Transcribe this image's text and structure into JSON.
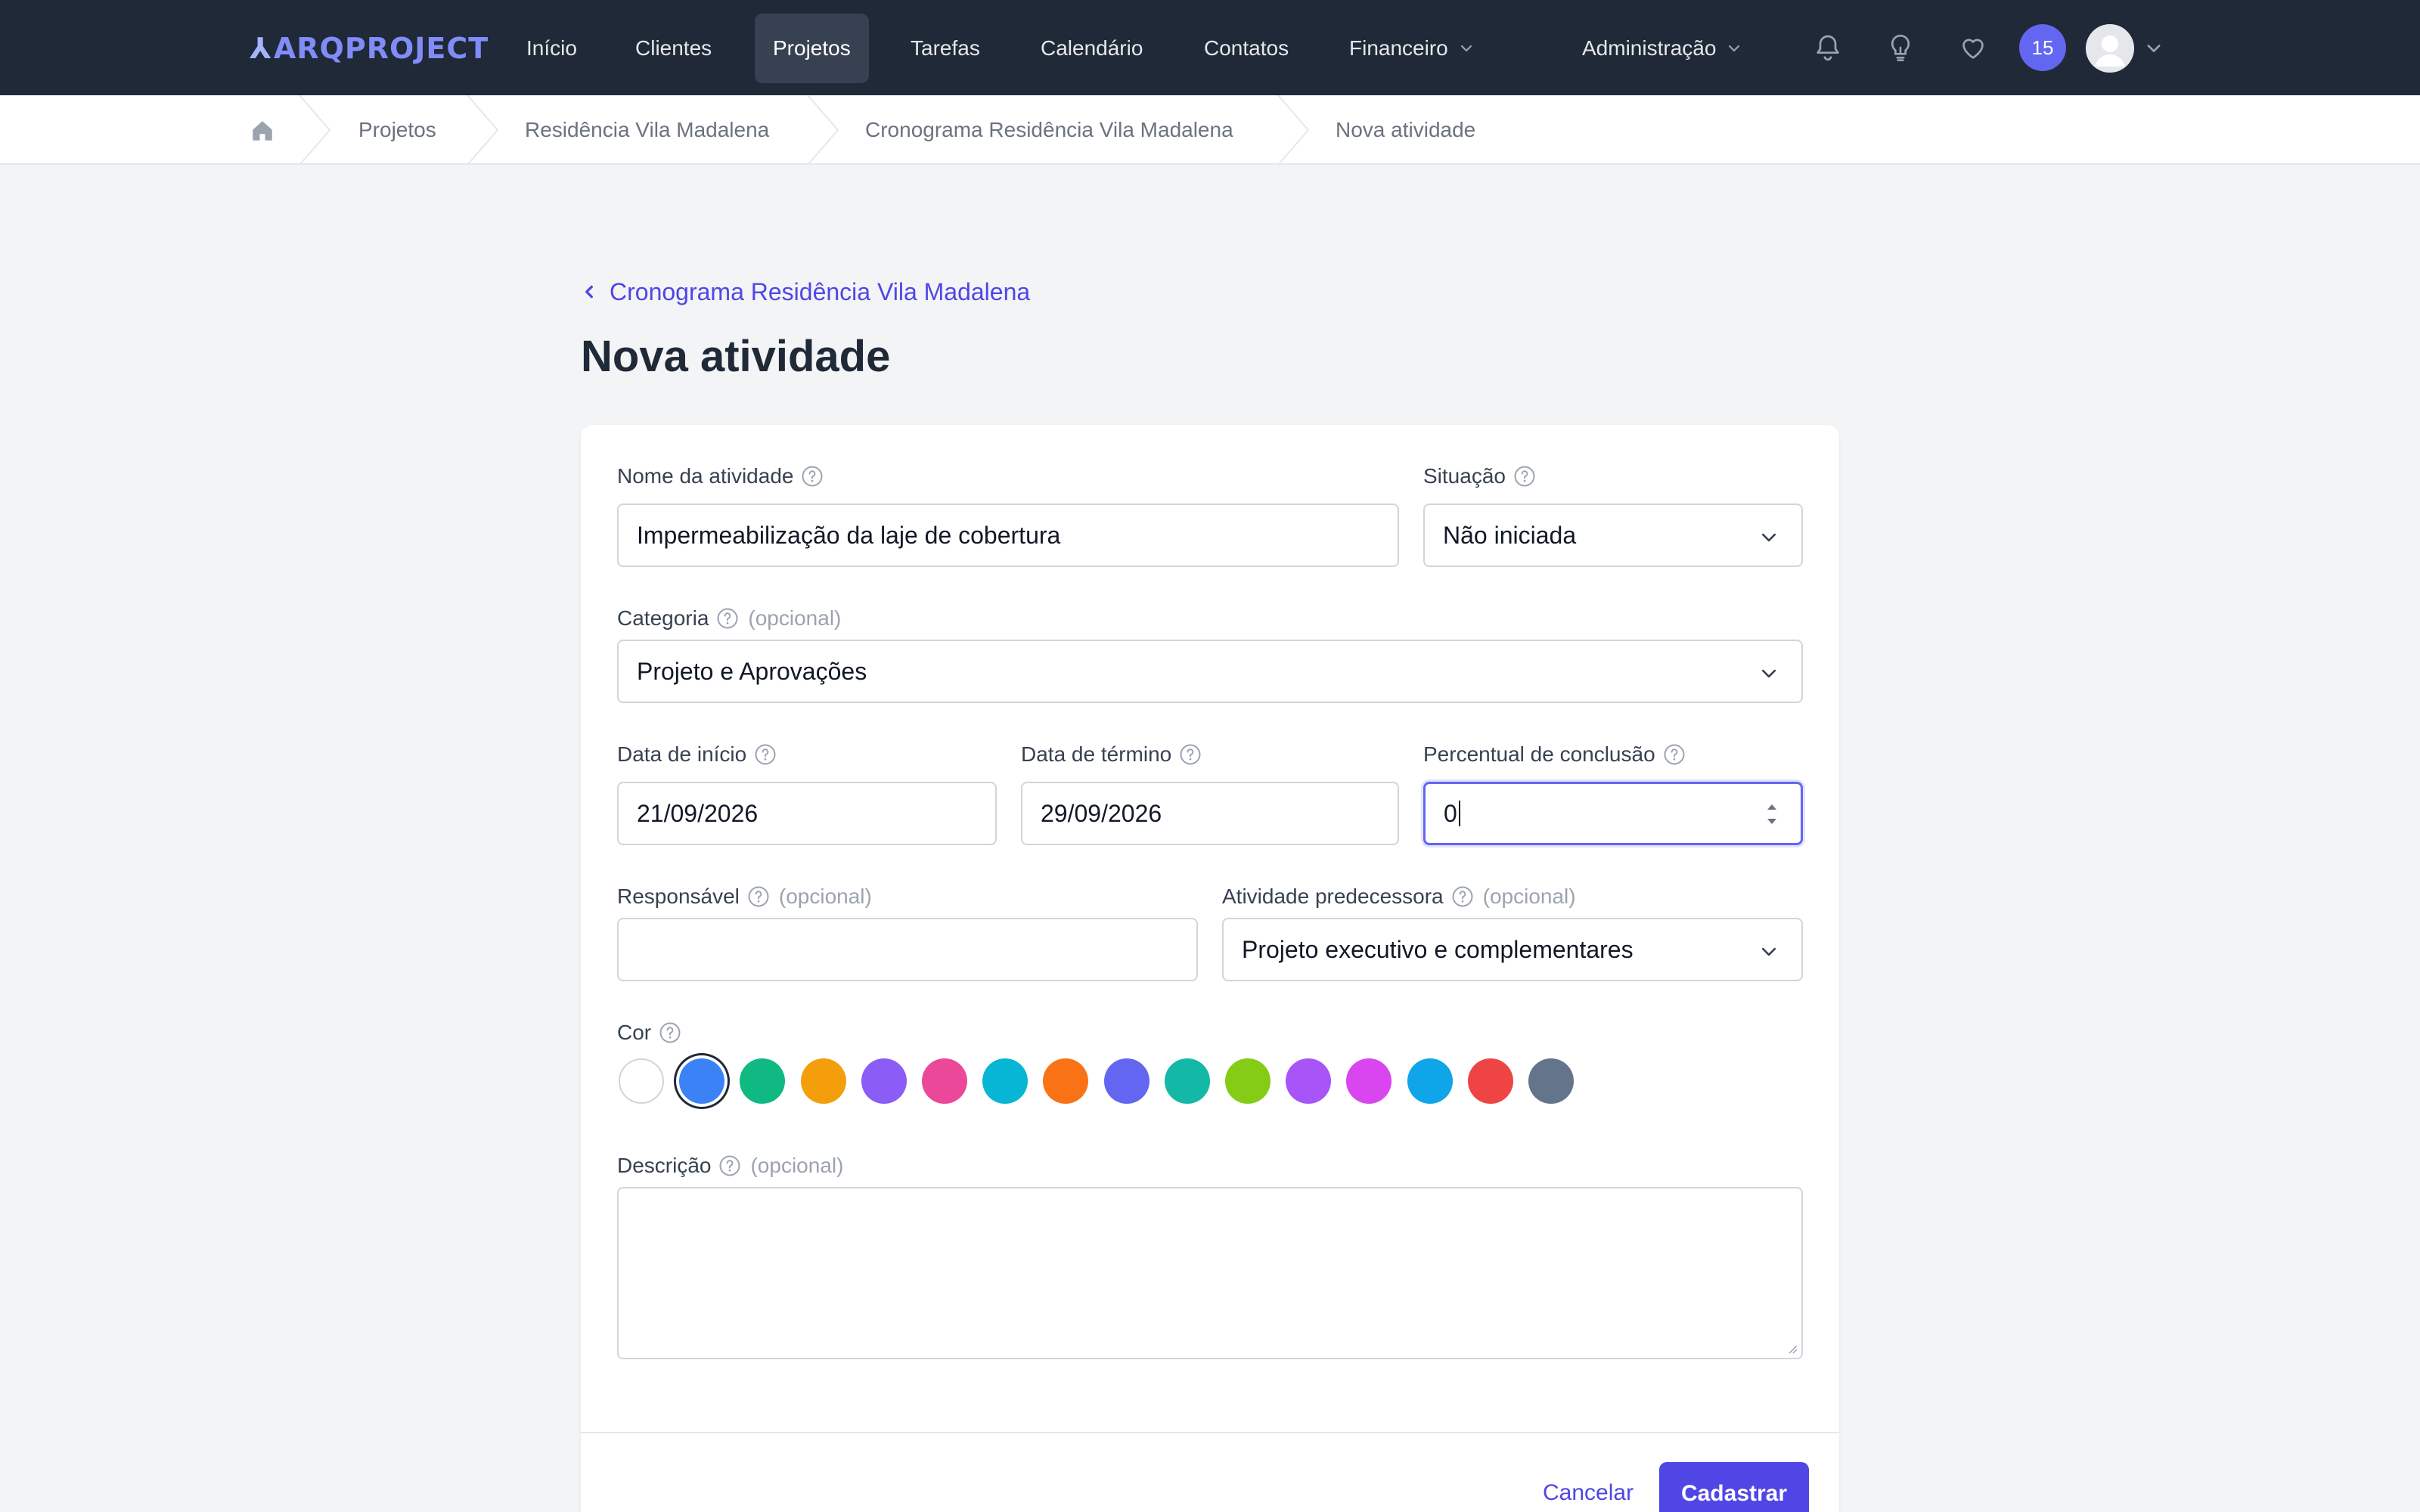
{
  "app": {
    "logo_mark": "⅄",
    "logo_text": "ARQPROJECT"
  },
  "nav": {
    "items": [
      {
        "label": "Início"
      },
      {
        "label": "Clientes"
      },
      {
        "label": "Projetos",
        "active": true
      },
      {
        "label": "Tarefas"
      },
      {
        "label": "Calendário"
      },
      {
        "label": "Contatos"
      },
      {
        "label": "Financeiro",
        "dropdown": true
      }
    ],
    "admin_label": "Administração",
    "notification_count": "15"
  },
  "breadcrumb": [
    "Projetos",
    "Residência Vila Madalena",
    "Cronograma Residência Vila Madalena",
    "Nova atividade"
  ],
  "back_link": "Cronograma Residência Vila Madalena",
  "page_title": "Nova atividade",
  "form": {
    "nome": {
      "label": "Nome da atividade",
      "value": "Impermeabilização da laje de cobertura"
    },
    "situacao": {
      "label": "Situação",
      "value": "Não iniciada"
    },
    "categoria": {
      "label": "Categoria",
      "optional": "(opcional)",
      "value": "Projeto e Aprovações"
    },
    "data_inicio": {
      "label": "Data de início",
      "value": "21/09/2026"
    },
    "data_termino": {
      "label": "Data de término",
      "value": "29/09/2026"
    },
    "percentual": {
      "label": "Percentual de conclusão",
      "value": "0"
    },
    "responsavel": {
      "label": "Responsável",
      "optional": "(opcional)",
      "value": ""
    },
    "predecessora": {
      "label": "Atividade predecessora",
      "optional": "(opcional)",
      "value": "Projeto executivo e complementares"
    },
    "cor": {
      "label": "Cor",
      "selected_index": 1,
      "swatches": [
        "#ffffff",
        "#3b82f6",
        "#10b981",
        "#f59e0b",
        "#8b5cf6",
        "#ec4899",
        "#06b6d4",
        "#f97316",
        "#6366f1",
        "#14b8a6",
        "#84cc16",
        "#a855f7",
        "#d946ef",
        "#0ea5e9",
        "#ef4444",
        "#64748b"
      ]
    },
    "descricao": {
      "label": "Descrição",
      "optional": "(opcional)",
      "value": ""
    }
  },
  "actions": {
    "cancel": "Cancelar",
    "submit": "Cadastrar"
  },
  "colors": {
    "nav_bg": "#1f2937",
    "accent": "#4f46e5",
    "badge": "#6366f1"
  }
}
